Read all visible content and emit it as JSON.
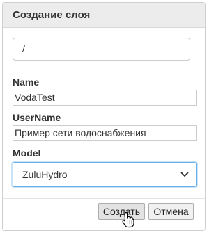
{
  "dialog": {
    "title": "Создание слоя",
    "path_value": "/",
    "fields": {
      "name_label": "Name",
      "name_value": "VodaTest",
      "username_label": "UserName",
      "username_value": "Пример сети водоснабжения",
      "model_label": "Model",
      "model_value": "ZuluHydro"
    },
    "buttons": {
      "create_label": "Создать",
      "cancel_label": "Отмена"
    }
  },
  "colors": {
    "header_bg": "#ececec",
    "focus_border": "#66afe9"
  },
  "icons": [
    "chevron-down-icon",
    "hand-pointer-icon"
  ]
}
